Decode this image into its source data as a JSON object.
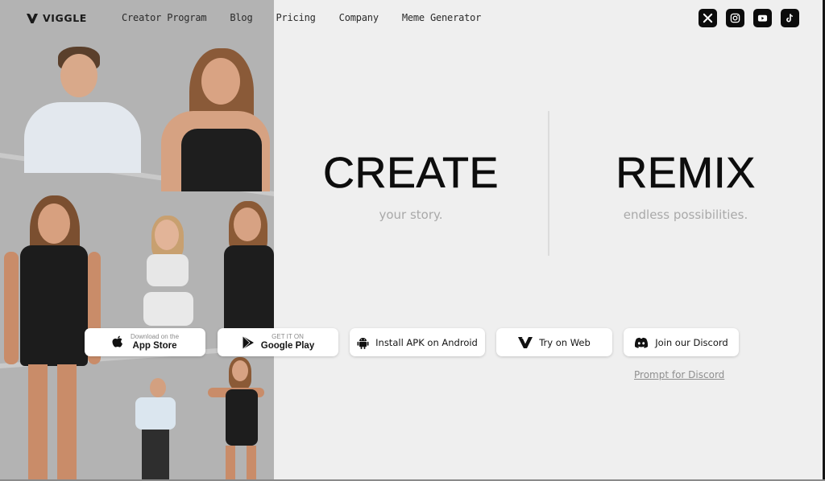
{
  "header": {
    "logo_text": "VIGGLE",
    "nav": [
      {
        "label": "Creator Program"
      },
      {
        "label": "Blog"
      },
      {
        "label": "Pricing"
      },
      {
        "label": "Company"
      },
      {
        "label": "Meme Generator"
      }
    ],
    "socials": [
      {
        "name": "x-icon",
        "label": "X"
      },
      {
        "name": "instagram-icon",
        "label": "Instagram"
      },
      {
        "name": "youtube-icon",
        "label": "YouTube"
      },
      {
        "name": "tiktok-icon",
        "label": "TikTok"
      }
    ]
  },
  "hero": {
    "create_title": "CREATE",
    "create_subtitle": "your story.",
    "remix_title": "REMIX",
    "remix_subtitle": "endless possibilities."
  },
  "buttons": {
    "appstore_small": "Download on the",
    "appstore_big": "App Store",
    "googleplay_small": "GET IT ON",
    "googleplay_big": "Google Play",
    "apk": "Install APK on Android",
    "web": "Try on Web",
    "discord": "Join our Discord"
  },
  "links": {
    "prompt_for_discord": "Prompt for Discord"
  },
  "colors": {
    "background": "#efefef",
    "collage_background": "#b3b3b3",
    "social_bg": "#0c0c0c",
    "subtitle": "#a9a9a9"
  }
}
